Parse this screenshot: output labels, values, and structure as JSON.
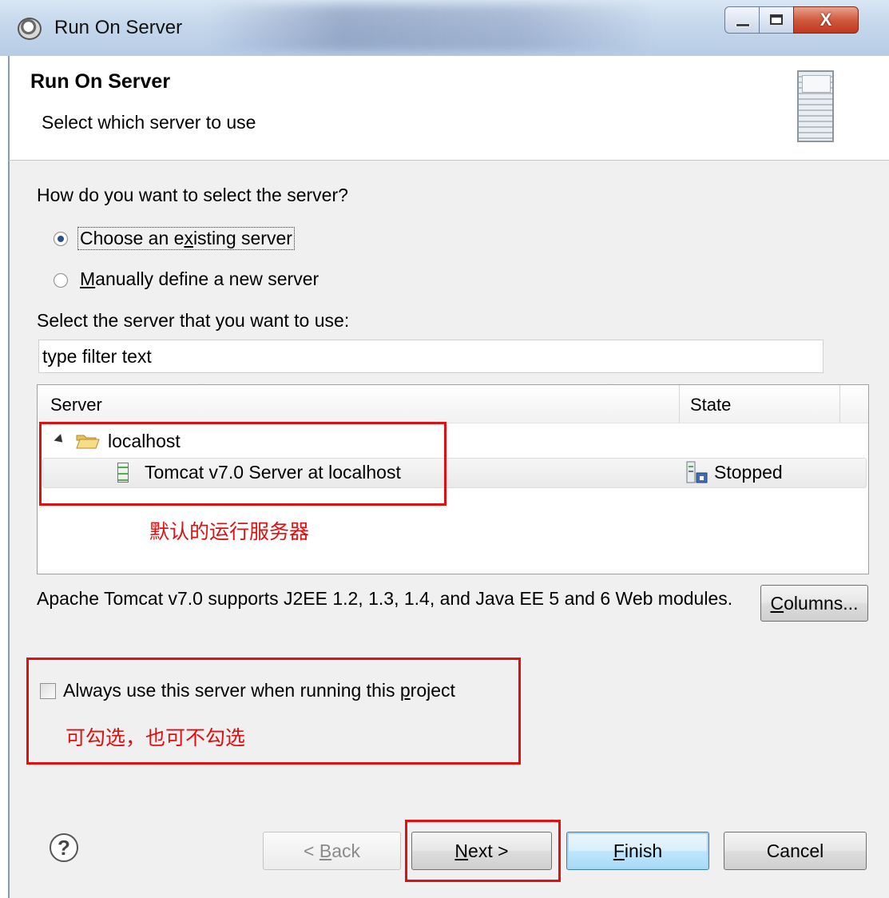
{
  "window": {
    "title": "Run On Server",
    "close_glyph": "X"
  },
  "header": {
    "title": "Run On Server",
    "subtitle": "Select which server to use",
    "icon": "server-icon"
  },
  "selection": {
    "question": "How do you want to select the server?",
    "option_existing": {
      "pre": "Choose an e",
      "mnemonic": "x",
      "post": "isting server",
      "selected": true
    },
    "option_manual": {
      "mnemonic": "M",
      "post": "anually define a new server",
      "selected": false
    }
  },
  "server_list": {
    "label": "Select the server that you want to use:",
    "filter_value": "type filter text",
    "columns": [
      "Server",
      "State"
    ],
    "group": "localhost",
    "servers": [
      {
        "name": "Tomcat v7.0 Server at localhost",
        "state": "Stopped"
      }
    ]
  },
  "annotations": {
    "default_server_note": "默认的运行服务器",
    "checkbox_note": "可勾选，也可不勾选",
    "color": "#e01010"
  },
  "description": "Apache Tomcat v7.0 supports J2EE 1.2, 1.3, 1.4, and Java EE 5 and 6 Web modules.",
  "columns_button": {
    "mnemonic": "C",
    "post": "olumns..."
  },
  "always_use": {
    "pre": "Always use this server when running this ",
    "mnemonic": "p",
    "post": "roject",
    "checked": false
  },
  "footer": {
    "help_glyph": "?",
    "back": {
      "pre": "< ",
      "mnemonic": "B",
      "post": "ack",
      "enabled": false
    },
    "next": {
      "mnemonic": "N",
      "post": "ext >"
    },
    "finish": {
      "mnemonic": "F",
      "post": "inish"
    },
    "cancel": "Cancel"
  },
  "colors": {
    "title_bar": "#c5d7ec",
    "dialog_bg": "#f0f0f0",
    "default_button": "#bee6fd"
  }
}
